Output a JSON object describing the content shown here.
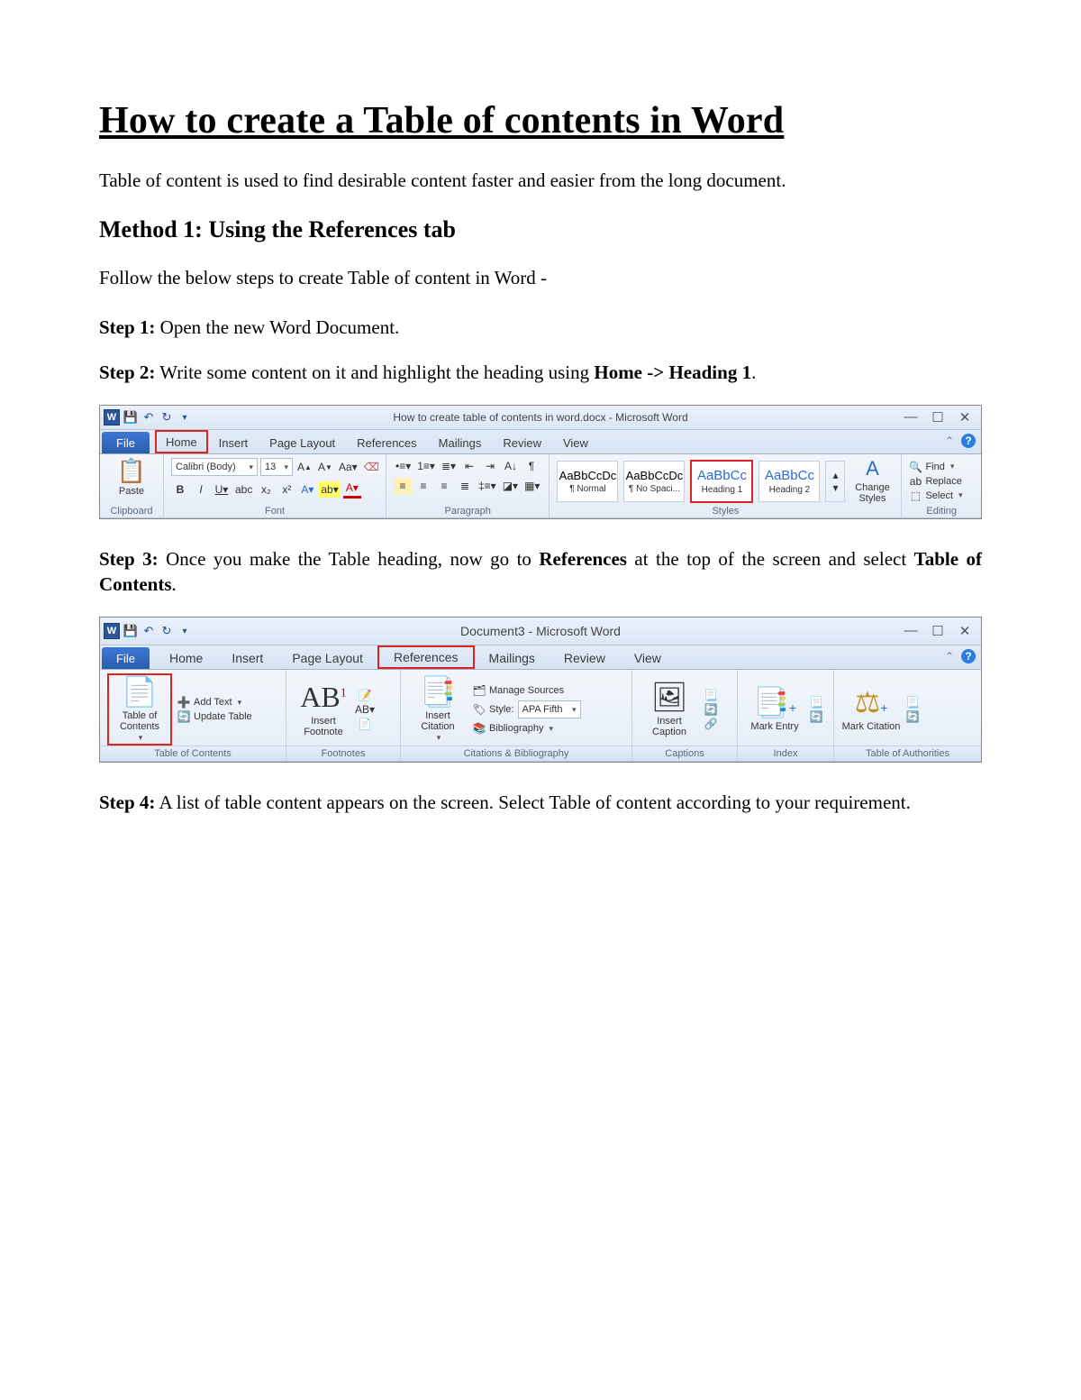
{
  "title": "How to create a Table of contents in Word",
  "intro": "Table of content is used to find desirable content faster and easier from the long document.",
  "method_heading": "Method 1: Using the References tab",
  "method_intro": "Follow the below steps to create Table of content in Word -",
  "step1_label": "Step 1:",
  "step1_text": " Open the new Word Document.",
  "step2_label": "Step 2:",
  "step2_text": " Write some content on it and highlight the heading using ",
  "step2_bold": "Home -> Heading 1",
  "step2_tail": ".",
  "step3_label": "Step 3:",
  "step3_text_a": " Once you make the Table heading, now go to ",
  "step3_bold_a": "References",
  "step3_text_b": " at the top of the screen and select ",
  "step3_bold_b": "Table of Contents",
  "step3_tail": ".",
  "step4_label": "Step 4:",
  "step4_text": " A list of table content appears on the screen. Select Table of content according to your requirement.",
  "shot1": {
    "doc_title": "How to create table of contents in word.docx  - Microsoft Word",
    "word_icon": "W",
    "file_tab": "File",
    "tabs": [
      "Home",
      "Insert",
      "Page Layout",
      "References",
      "Mailings",
      "Review",
      "View"
    ],
    "clipboard": {
      "paste": "Paste",
      "label": "Clipboard"
    },
    "font": {
      "name": "Calibri (Body)",
      "size": "13",
      "label": "Font"
    },
    "paragraph_label": "Paragraph",
    "styles": {
      "items": [
        {
          "sample": "AaBbCcDc",
          "name": "¶ Normal"
        },
        {
          "sample": "AaBbCcDc",
          "name": "¶ No Spaci..."
        },
        {
          "sample": "AaBbC​c",
          "name": "Heading 1"
        },
        {
          "sample": "AaBbCc",
          "name": "Heading 2"
        }
      ],
      "change": "Change Styles",
      "label": "Styles"
    },
    "editing": {
      "find": "Find",
      "replace": "Replace",
      "select": "Select",
      "label": "Editing"
    }
  },
  "shot2": {
    "doc_title": "Document3  - Microsoft Word",
    "word_icon": "W",
    "file_tab": "File",
    "tabs": [
      "Home",
      "Insert",
      "Page Layout",
      "References",
      "Mailings",
      "Review",
      "View"
    ],
    "groups": {
      "toc": {
        "btn": "Table of Contents",
        "add": "Add Text",
        "update": "Update Table",
        "label": "Table of Contents"
      },
      "footnotes": {
        "btn": "Insert Footnote",
        "ab": "AB",
        "label": "Footnotes"
      },
      "citations": {
        "btn": "Insert Citation",
        "manage": "Manage Sources",
        "style_lbl": "Style:",
        "style_val": "APA Fift​h",
        "bib": "Bibliography",
        "label": "Citations & Bibliography"
      },
      "captions": {
        "btn": "Insert Caption",
        "label": "Captions"
      },
      "index": {
        "btn": "Mark Entry",
        "label": "Index"
      },
      "toa": {
        "btn": "Mark Citation",
        "label": "Table of Authorities"
      }
    }
  }
}
